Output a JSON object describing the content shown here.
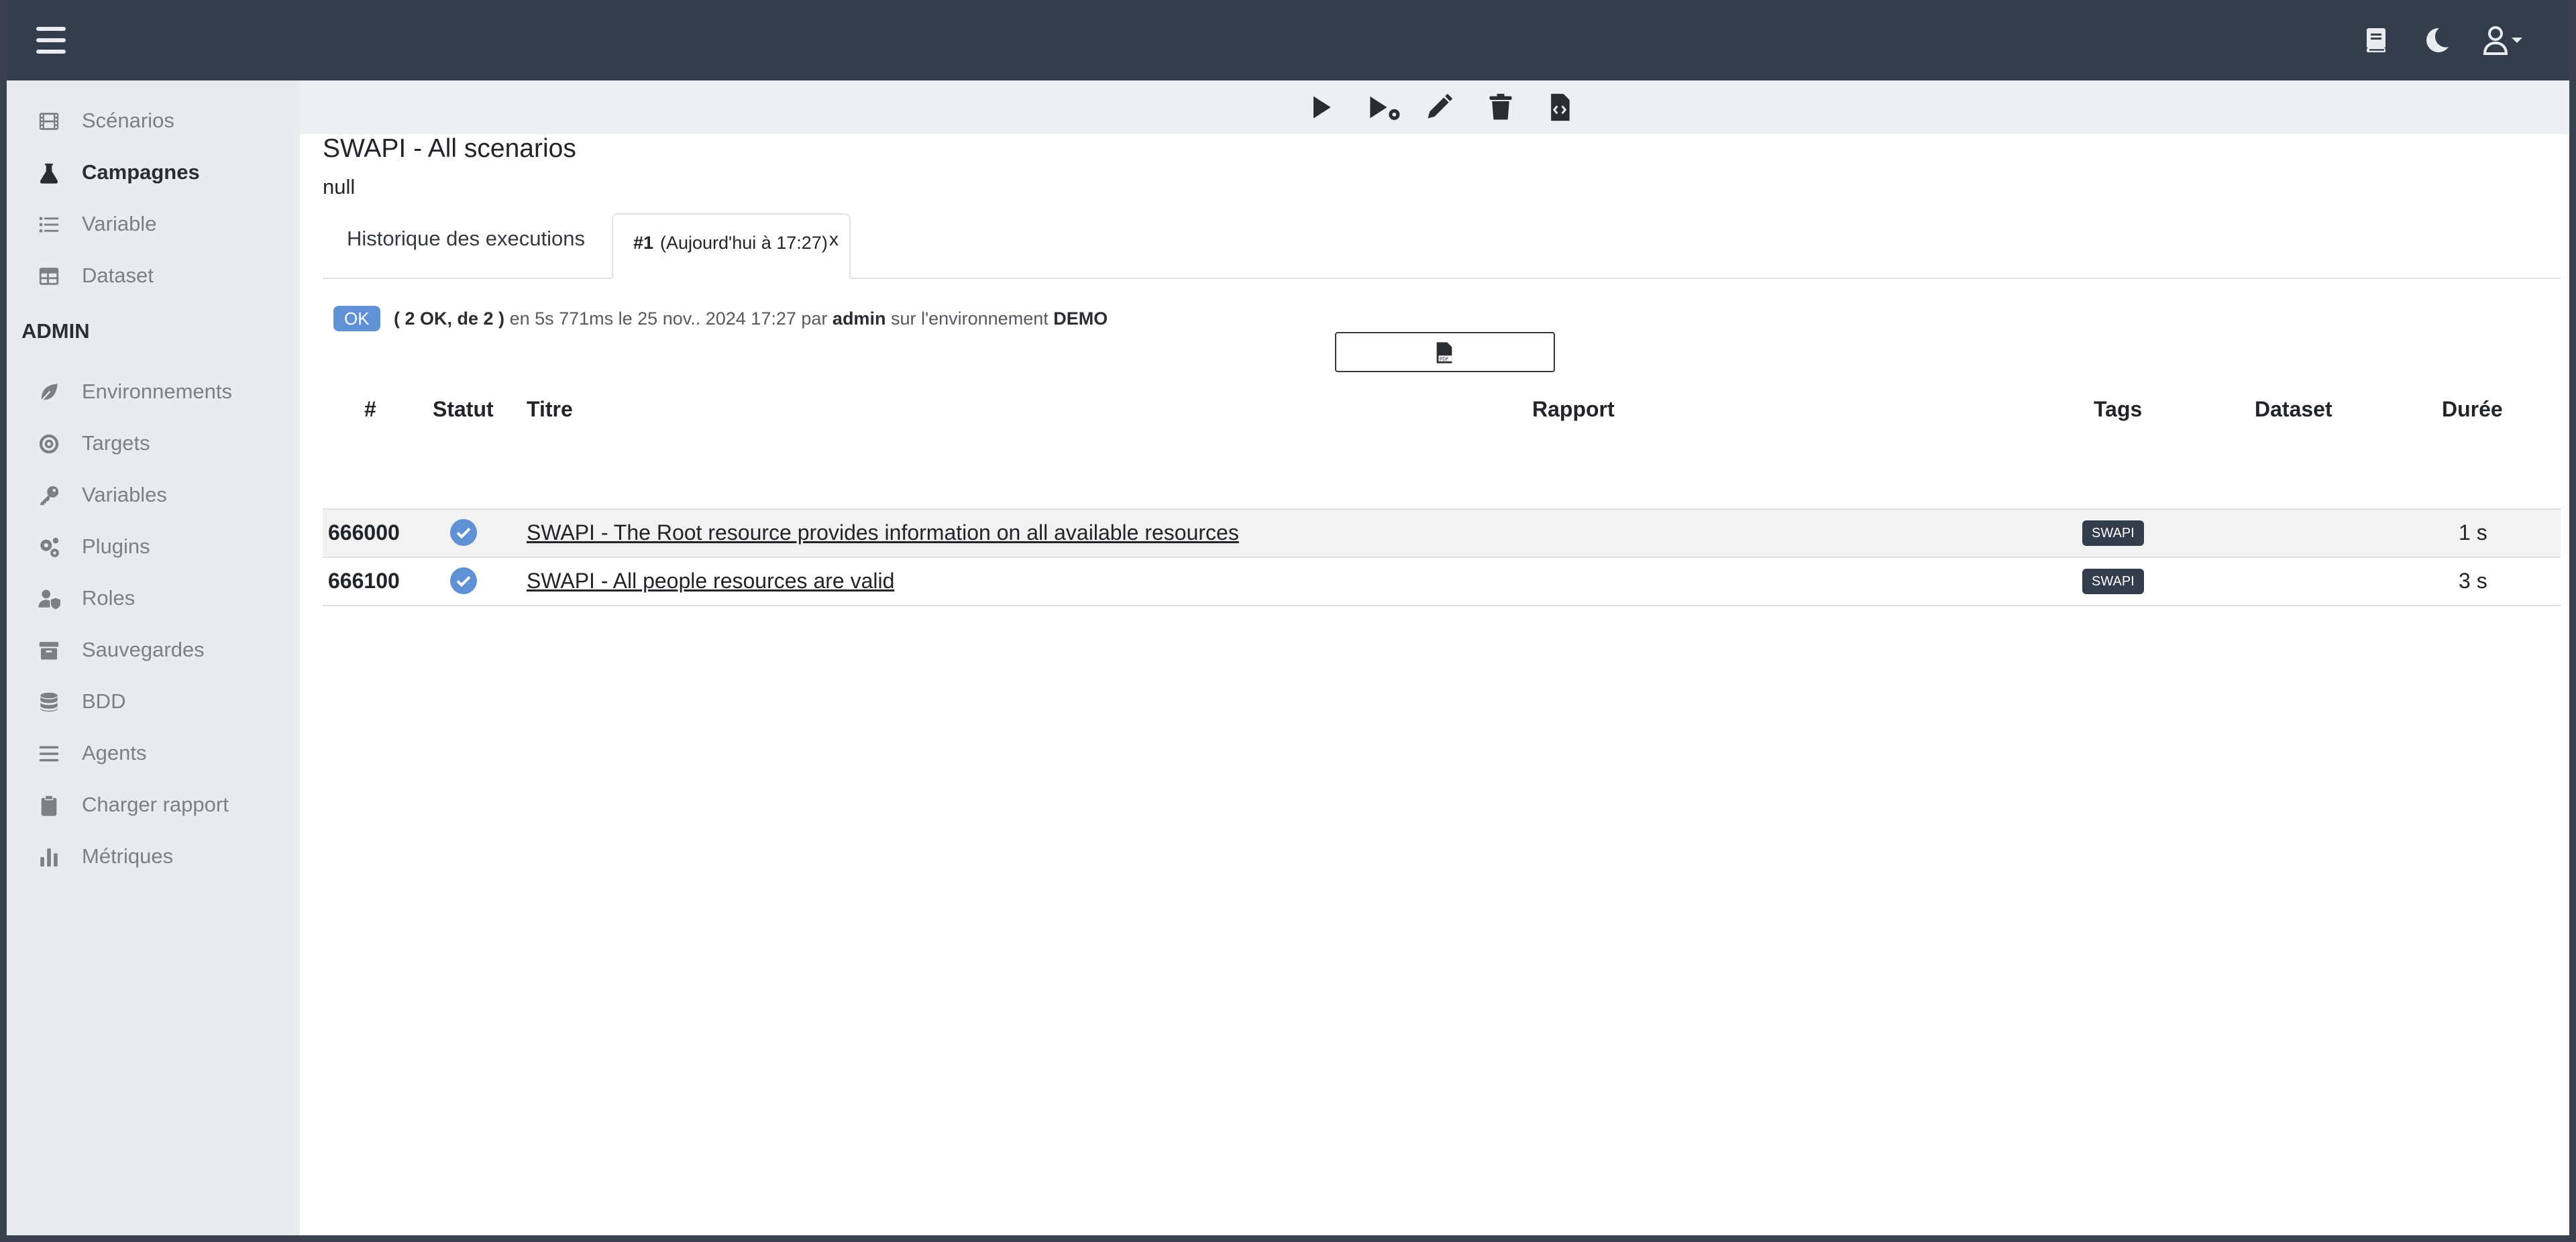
{
  "sidebar": {
    "items": [
      {
        "label": "Scénarios",
        "icon": "film-icon"
      },
      {
        "label": "Campagnes",
        "icon": "flask-icon",
        "active": true
      },
      {
        "label": "Variable",
        "icon": "list-icon"
      },
      {
        "label": "Dataset",
        "icon": "table-icon"
      }
    ],
    "admin_heading": "ADMIN",
    "admin_items": [
      {
        "label": "Environnements",
        "icon": "leaf-icon"
      },
      {
        "label": "Targets",
        "icon": "target-icon"
      },
      {
        "label": "Variables",
        "icon": "key-icon"
      },
      {
        "label": "Plugins",
        "icon": "gears-icon"
      },
      {
        "label": "Roles",
        "icon": "user-shield-icon"
      },
      {
        "label": "Sauvegardes",
        "icon": "archive-icon"
      },
      {
        "label": "BDD",
        "icon": "database-icon"
      },
      {
        "label": "Agents",
        "icon": "bars-icon"
      },
      {
        "label": "Charger rapport",
        "icon": "clipboard-icon"
      },
      {
        "label": "Métriques",
        "icon": "chart-bar-icon"
      }
    ]
  },
  "main": {
    "title": "SWAPI - All scenarios",
    "subtitle": "null",
    "tabs": {
      "history_label": "Historique des executions",
      "active_number": "#1",
      "active_date": "(Aujourd'hui à 17:27)",
      "close_glyph": "x"
    },
    "summary": {
      "status_badge": "OK",
      "counts": "( 2 OK, de 2 )",
      "text_1": "en 5s 771ms le 25 nov.. 2024 17:27 par",
      "user": "admin",
      "text_2": "sur l'environnement",
      "environment": "DEMO"
    },
    "table": {
      "headers": {
        "num": "#",
        "status": "Statut",
        "title": "Titre",
        "report": "Rapport",
        "tags": "Tags",
        "dataset": "Dataset",
        "duration": "Durée"
      },
      "rows": [
        {
          "id": "666000",
          "title": "SWAPI - The Root resource provides information on all available resources",
          "tag": "SWAPI",
          "duration": "1 s"
        },
        {
          "id": "666100",
          "title": "SWAPI - All people resources are valid",
          "tag": "SWAPI",
          "duration": "3 s"
        }
      ]
    }
  },
  "colors": {
    "navbar": "#343d4b",
    "sidebar": "#e9ecee",
    "accent": "#5f91d4"
  }
}
